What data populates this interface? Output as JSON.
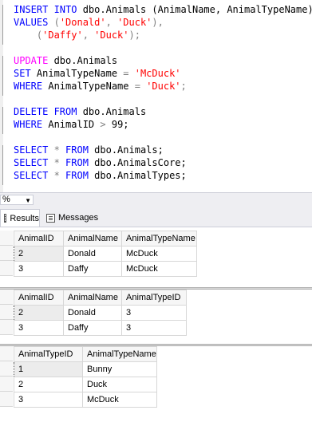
{
  "editor": {
    "lines": [
      [
        {
          "t": "INSERT INTO ",
          "c": "kw"
        },
        {
          "t": "dbo.Animals (AnimalName, AnimalTypeName)",
          "c": ""
        }
      ],
      [
        {
          "t": "VALUES ",
          "c": "kw"
        },
        {
          "t": "(",
          "c": "gr"
        },
        {
          "t": "'Donald'",
          "c": "str"
        },
        {
          "t": ", ",
          "c": "gr"
        },
        {
          "t": "'Duck'",
          "c": "str"
        },
        {
          "t": "),",
          "c": "gr"
        }
      ],
      [
        {
          "t": "    (",
          "c": "gr"
        },
        {
          "t": "'Daffy'",
          "c": "str"
        },
        {
          "t": ", ",
          "c": "gr"
        },
        {
          "t": "'Duck'",
          "c": "str"
        },
        {
          "t": ");",
          "c": "gr"
        }
      ],
      [],
      [
        {
          "t": "UPDATE ",
          "c": "kwp"
        },
        {
          "t": "dbo.Animals",
          "c": ""
        }
      ],
      [
        {
          "t": "SET ",
          "c": "kw"
        },
        {
          "t": "AnimalTypeName ",
          "c": ""
        },
        {
          "t": "= ",
          "c": "gr"
        },
        {
          "t": "'McDuck'",
          "c": "str"
        }
      ],
      [
        {
          "t": "WHERE ",
          "c": "kw"
        },
        {
          "t": "AnimalTypeName ",
          "c": ""
        },
        {
          "t": "= ",
          "c": "gr"
        },
        {
          "t": "'Duck'",
          "c": "str"
        },
        {
          "t": ";",
          "c": "gr"
        }
      ],
      [],
      [
        {
          "t": "DELETE FROM ",
          "c": "kw"
        },
        {
          "t": "dbo.Animals",
          "c": ""
        }
      ],
      [
        {
          "t": "WHERE ",
          "c": "kw"
        },
        {
          "t": "AnimalID ",
          "c": ""
        },
        {
          "t": "> ",
          "c": "gr"
        },
        {
          "t": "99;",
          "c": ""
        }
      ],
      [],
      [
        {
          "t": "SELECT ",
          "c": "kw"
        },
        {
          "t": "* ",
          "c": "gr"
        },
        {
          "t": "FROM ",
          "c": "kw"
        },
        {
          "t": "dbo.Animals;",
          "c": ""
        }
      ],
      [
        {
          "t": "SELECT ",
          "c": "kw"
        },
        {
          "t": "* ",
          "c": "gr"
        },
        {
          "t": "FROM ",
          "c": "kw"
        },
        {
          "t": "dbo.AnimalsCore;",
          "c": ""
        }
      ],
      [
        {
          "t": "SELECT ",
          "c": "kw"
        },
        {
          "t": "* ",
          "c": "gr"
        },
        {
          "t": "FROM ",
          "c": "kw"
        },
        {
          "t": "dbo.AnimalTypes;",
          "c": ""
        }
      ]
    ]
  },
  "zoom": {
    "value": "%"
  },
  "tabs": {
    "results": "Results",
    "messages": "Messages"
  },
  "grids": [
    {
      "columns": [
        "AnimalID",
        "AnimalName",
        "AnimalTypeName"
      ],
      "rows": [
        [
          "2",
          "Donald",
          "McDuck"
        ],
        [
          "3",
          "Daffy",
          "McDuck"
        ]
      ]
    },
    {
      "columns": [
        "AnimalID",
        "AnimalName",
        "AnimalTypeID"
      ],
      "rows": [
        [
          "2",
          "Donald",
          "3"
        ],
        [
          "3",
          "Daffy",
          "3"
        ]
      ]
    },
    {
      "columns": [
        "AnimalTypeID",
        "AnimalTypeName"
      ],
      "rows": [
        [
          "1",
          "Bunny"
        ],
        [
          "2",
          "Duck"
        ],
        [
          "3",
          "McDuck"
        ]
      ]
    }
  ],
  "colors": {
    "keyword": "#0000ff",
    "keyword_dml": "#ff00ff",
    "string": "#ff0000",
    "operator": "#808080"
  }
}
